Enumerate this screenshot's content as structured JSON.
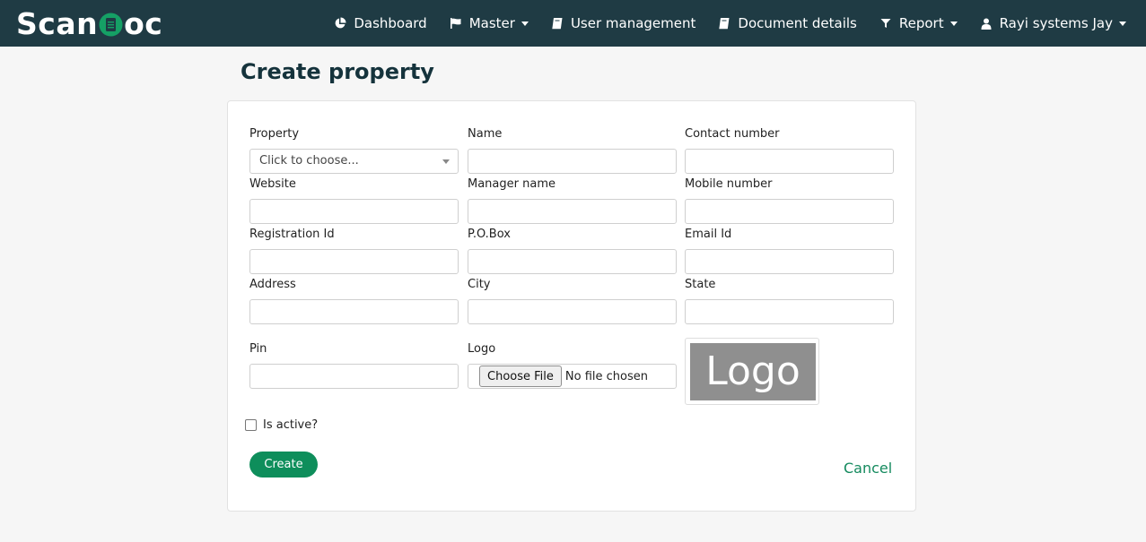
{
  "app": {
    "brand_left": "Scan",
    "brand_right": "oc"
  },
  "nav": {
    "dashboard": "Dashboard",
    "master": "Master",
    "user_management": "User management",
    "document_details": "Document details",
    "report": "Report",
    "user": "Rayi systems Jay"
  },
  "page": {
    "title": "Create property"
  },
  "form": {
    "property": {
      "label": "Property",
      "value": "Click to choose..."
    },
    "name": {
      "label": "Name",
      "value": ""
    },
    "contact_number": {
      "label": "Contact number",
      "value": ""
    },
    "website": {
      "label": "Website",
      "value": ""
    },
    "manager_name": {
      "label": "Manager name",
      "value": ""
    },
    "mobile_number": {
      "label": "Mobile number",
      "value": ""
    },
    "registration_id": {
      "label": "Registration Id",
      "value": ""
    },
    "po_box": {
      "label": "P.O.Box",
      "value": ""
    },
    "email_id": {
      "label": "Email Id",
      "value": ""
    },
    "address": {
      "label": "Address",
      "value": ""
    },
    "city": {
      "label": "City",
      "value": ""
    },
    "state": {
      "label": "State",
      "value": ""
    },
    "pin": {
      "label": "Pin",
      "value": ""
    },
    "logo": {
      "label": "Logo",
      "button": "Choose File",
      "status": "No file chosen",
      "preview_text": "Logo"
    },
    "is_active": {
      "label": "Is active?",
      "checked": false
    },
    "create_label": "Create",
    "cancel_label": "Cancel"
  },
  "colors": {
    "navbar": "#1f3b44",
    "accent": "#0e8e5b",
    "cancel": "#148a5e"
  }
}
